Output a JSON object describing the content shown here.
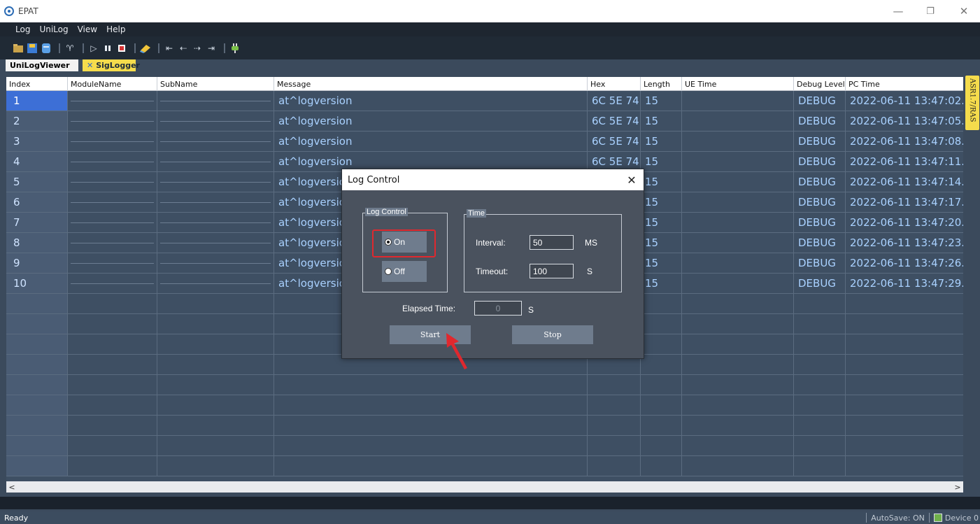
{
  "window": {
    "title": "EPAT",
    "controls": [
      "—",
      "❐",
      "✕"
    ]
  },
  "menu": [
    "Log",
    "UniLog",
    "View",
    "Help"
  ],
  "toolbar_icons": [
    "open-folder-icon",
    "save-icon",
    "database-icon",
    "filter-icon",
    "play-icon",
    "pause-icon",
    "stop-icon",
    "clear-icon",
    "first-icon",
    "prev-icon",
    "next-icon",
    "last-icon",
    "plugin-icon"
  ],
  "tabs": [
    {
      "label": "UniLogViewer"
    },
    {
      "label": "SigLogger",
      "close": "✕"
    }
  ],
  "grid": {
    "columns": [
      "Index",
      "ModuleName",
      "SubName",
      "Message",
      "Hex",
      "Length",
      "UE Time",
      "Debug Level",
      "PC Time"
    ],
    "rows": [
      {
        "index": "1",
        "message": "at^logversion",
        "hex": "6C 5E 74",
        "length": "15",
        "level": "DEBUG",
        "pc_time": "2022-06-11 13:47:02."
      },
      {
        "index": "2",
        "message": "at^logversion",
        "hex": "6C 5E 74",
        "length": "15",
        "level": "DEBUG",
        "pc_time": "2022-06-11 13:47:05."
      },
      {
        "index": "3",
        "message": "at^logversion",
        "hex": "6C 5E 74",
        "length": "15",
        "level": "DEBUG",
        "pc_time": "2022-06-11 13:47:08."
      },
      {
        "index": "4",
        "message": "at^logversion",
        "hex": "6C 5E 74",
        "length": "15",
        "level": "DEBUG",
        "pc_time": "2022-06-11 13:47:11."
      },
      {
        "index": "5",
        "message": "at^logversio",
        "hex": "",
        "length": "15",
        "level": "DEBUG",
        "pc_time": "2022-06-11 13:47:14."
      },
      {
        "index": "6",
        "message": "at^logversio",
        "hex": "",
        "length": "15",
        "level": "DEBUG",
        "pc_time": "2022-06-11 13:47:17."
      },
      {
        "index": "7",
        "message": "at^logversio",
        "hex": "",
        "length": "15",
        "level": "DEBUG",
        "pc_time": "2022-06-11 13:47:20."
      },
      {
        "index": "8",
        "message": "at^logversio",
        "hex": "",
        "length": "15",
        "level": "DEBUG",
        "pc_time": "2022-06-11 13:47:23."
      },
      {
        "index": "9",
        "message": "at^logversio",
        "hex": "",
        "length": "15",
        "level": "DEBUG",
        "pc_time": "2022-06-11 13:47:26."
      },
      {
        "index": "10",
        "message": "at^logversio",
        "hex": "",
        "length": "15",
        "level": "DEBUG",
        "pc_time": "2022-06-11 13:47:29."
      }
    ],
    "selected_index": "1"
  },
  "side_tab": "ASR1.7/RAS",
  "scroll": {
    "left": "<",
    "right": ">"
  },
  "status": {
    "left": "Ready",
    "autosave": "AutoSave: ON",
    "device": "Device 0"
  },
  "dialog": {
    "title": "Log Control",
    "close": "✕",
    "log_control_group": "Log Control",
    "on_label": "On",
    "off_label": "Off",
    "selected": "On",
    "time_group": "Time",
    "interval_label": "Interval:",
    "interval_value": "50",
    "interval_unit": "MS",
    "timeout_label": "Timeout:",
    "timeout_value": "100",
    "timeout_unit": "S",
    "elapsed_label": "Elapsed Time:",
    "elapsed_value": "0",
    "elapsed_unit": "S",
    "start_label": "Start",
    "stop_label": "Stop"
  },
  "colors": {
    "highlight_red": "#e0282e",
    "tab_yellow": "#f5dc4c",
    "selected_index_blue": "#3d6fd6",
    "grid_text": "#a9d1ff"
  }
}
